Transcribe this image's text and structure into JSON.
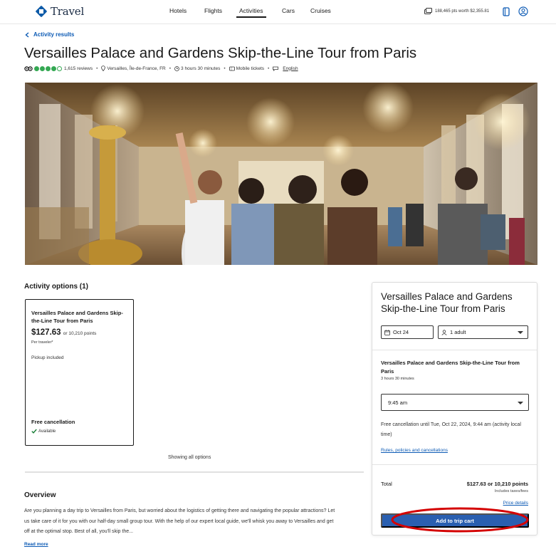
{
  "brand": {
    "name": "Travel",
    "color": "#0e5ba8"
  },
  "nav": {
    "links": [
      {
        "label": "Hotels",
        "active": false
      },
      {
        "label": "Flights",
        "active": false
      },
      {
        "label": "Activities",
        "active": true
      },
      {
        "label": "Cars",
        "active": false
      },
      {
        "label": "Cruises",
        "active": false
      }
    ],
    "points_label": "188,465 pts worth $2,355.81",
    "icons": [
      "points-card-icon",
      "wallet-icon",
      "account-icon"
    ]
  },
  "breadcrumb": {
    "back_label": "Activity results"
  },
  "activity": {
    "title": "Versailles Palace and Gardens Skip-the-Line Tour from Paris",
    "rating": {
      "filled": 4,
      "total": 5,
      "reviews_label": "1,615 reviews"
    },
    "location": "Versailles, Île-de-France, FR",
    "duration": "3 hours 30 minutes",
    "ticket_type": "Mobile tickets",
    "language": "English"
  },
  "options": {
    "heading": "Activity options (1)",
    "card": {
      "title": "Versailles Palace and Gardens Skip-the-Line Tour from Paris",
      "price": "$127.63",
      "points": "or 10,210 points",
      "per": "Per traveler*",
      "pickup": "Pickup included",
      "free_cancel": "Free cancellation",
      "available": "Available"
    },
    "showing": "Showing all options"
  },
  "overview": {
    "heading": "Overview",
    "text": "Are you planning a day trip to Versailles from Paris, but worried about the logistics of getting there and navigating the popular attractions? Let us take care of it for you with our half-day small group tour. With the help of our expert local guide, we'll whisk you away to Versailles and get off at the optimal stop. Best of all, you'll skip the...",
    "read_more": "Read more"
  },
  "booking": {
    "title": "Versailles Palace and Gardens Skip-the-Line Tour from Paris",
    "date": "Oct 24",
    "travelers": "1 adult",
    "option_title": "Versailles Palace and Gardens Skip-the-Line Tour from Paris",
    "duration": "3 hours 30 minutes",
    "time": "9:45 am",
    "cancellation": "Free cancellation until Tue, Oct 22, 2024, 9:44 am (activity local time)",
    "rules_link": "Rules, policies and cancellations",
    "total_label": "Total",
    "total_value": "$127.63 or 10,210 points",
    "taxes": "Includes taxes/fees",
    "price_details": "Price details",
    "add_button": "Add to trip cart",
    "button_color": "#2a5fb0",
    "highlight_color": "#d40000"
  }
}
